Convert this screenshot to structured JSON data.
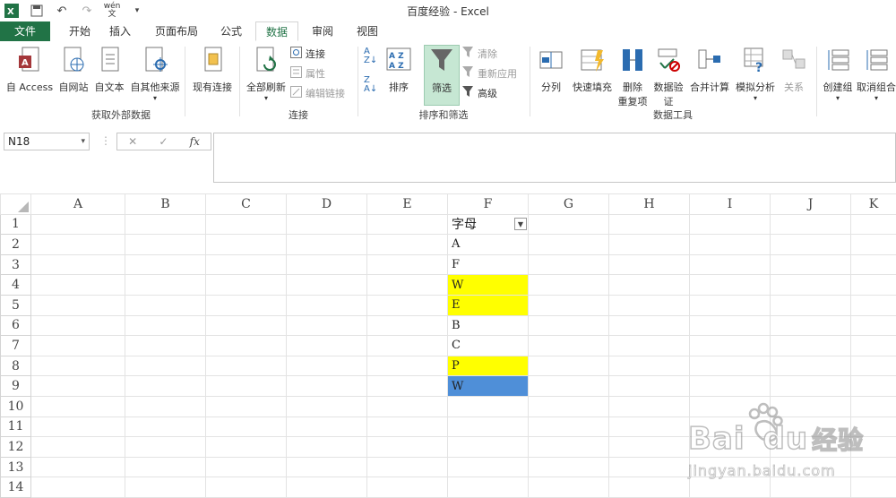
{
  "window": {
    "title": "百度经验 - Excel"
  },
  "tabs": [
    {
      "label": "文件"
    },
    {
      "label": "开始"
    },
    {
      "label": "插入"
    },
    {
      "label": "页面布局"
    },
    {
      "label": "公式"
    },
    {
      "label": "数据"
    },
    {
      "label": "审阅"
    },
    {
      "label": "视图"
    }
  ],
  "qat": {
    "wen_top": "wén",
    "wen_bottom": "文"
  },
  "ribbon": {
    "get_external": {
      "access": "自 Access",
      "web": "自网站",
      "text": "自文本",
      "other": "自其他来源",
      "existing": "现有连接",
      "group_label": "获取外部数据"
    },
    "connections": {
      "refresh_all": "全部刷新",
      "connections": "连接",
      "properties": "属性",
      "edit_links": "编辑链接",
      "group_label": "连接"
    },
    "sort_filter": {
      "sort_az": "A Z",
      "sort": "排序",
      "filter": "筛选",
      "clear": "清除",
      "reapply": "重新应用",
      "advanced": "高级",
      "group_label": "排序和筛选"
    },
    "data_tools": {
      "text_to_columns": "分列",
      "flash_fill": "快速填充",
      "remove_dup_1": "删除",
      "remove_dup_2": "重复项",
      "validation_1": "数据验",
      "validation_2": "证",
      "consolidate": "合并计算",
      "what_if": "模拟分析",
      "relationships": "关系",
      "group_label": "数据工具"
    },
    "outline": {
      "group": "创建组",
      "ungroup": "取消组合"
    }
  },
  "formula_bar": {
    "name_box": "N18",
    "fx": "fx",
    "value": ""
  },
  "sheet": {
    "columns": [
      "A",
      "B",
      "C",
      "D",
      "E",
      "F",
      "G",
      "H",
      "I",
      "J",
      "K"
    ],
    "rows": [
      "1",
      "2",
      "3",
      "4",
      "5",
      "6",
      "7",
      "8",
      "9",
      "10",
      "11",
      "12",
      "13",
      "14"
    ],
    "f_header": "字母",
    "f_values": [
      "A",
      "F",
      "W",
      "E",
      "B",
      "C",
      "P",
      "W"
    ],
    "highlight_colors": {
      "yellow": "#ffff00",
      "blue": "#4f8fd8"
    }
  },
  "watermark": {
    "brand": "Bai",
    "brand2": "du",
    "cn": "经验",
    "url": "jingyan.baidu.com"
  }
}
